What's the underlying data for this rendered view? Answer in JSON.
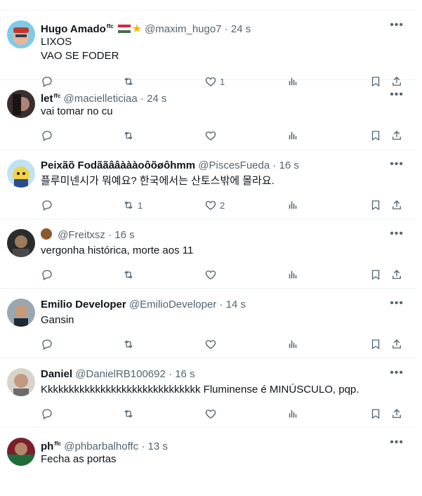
{
  "feed": {
    "posts": [
      {
        "name": "Hugo Amado",
        "badge": "ffc",
        "handle": "@maxim_hugo7",
        "time": "24 s",
        "text_lines": [
          "LIXOS",
          "VAO SE FODER"
        ],
        "reply_count": "",
        "repost_count": "",
        "like_count": "1"
      },
      {
        "name": "let",
        "badge": "ffc",
        "handle": "@macielleticiaa",
        "time": "24 s",
        "text_lines": [
          "vai tomar no cu"
        ],
        "reply_count": "",
        "repost_count": "",
        "like_count": ""
      },
      {
        "name": "Peixãõ Fodããââàààoôõøôhmm",
        "badge": "",
        "handle": "@PiscesFueda",
        "time": "16 s",
        "text_lines": [
          "플루미넨시가 뭐예요? 한국에서는 산토스밖에 몰라요."
        ],
        "reply_count": "",
        "repost_count": "1",
        "like_count": "2"
      },
      {
        "name": "",
        "badge": "",
        "handle": "@Freitxsz",
        "time": "16 s",
        "text_lines": [
          "vergonha histórica, morte aos 11"
        ],
        "reply_count": "",
        "repost_count": "",
        "like_count": ""
      },
      {
        "name": "Emilio Developer",
        "badge": "",
        "handle": "@EmilioDeveloper",
        "time": "14 s",
        "text_lines": [
          "Gansin"
        ],
        "reply_count": "",
        "repost_count": "",
        "like_count": ""
      },
      {
        "name": "Daniel",
        "badge": "",
        "handle": "@DanielRB100692",
        "time": "16 s",
        "text_lines": [
          "Kkkkkkkkkkkkkkkkkkkkkkkkkkkkkk Fluminense é MINÚSCULO, pqp."
        ],
        "reply_count": "",
        "repost_count": "",
        "like_count": ""
      },
      {
        "name": "ph",
        "badge": "ffc",
        "handle": "@phbarbalhoffc",
        "time": "13 s",
        "text_lines": [
          "Fecha as portas"
        ],
        "reply_count": "",
        "repost_count": "",
        "like_count": ""
      }
    ]
  },
  "icons": {
    "reply": "reply-icon",
    "repost": "repost-icon",
    "like": "heart-icon",
    "views": "views-icon",
    "bookmark": "bookmark-icon",
    "share": "share-icon",
    "more": "more-icon"
  },
  "colors": {
    "secondary_text": "#536471",
    "border": "#eff3f4",
    "star": "#f5b400"
  }
}
